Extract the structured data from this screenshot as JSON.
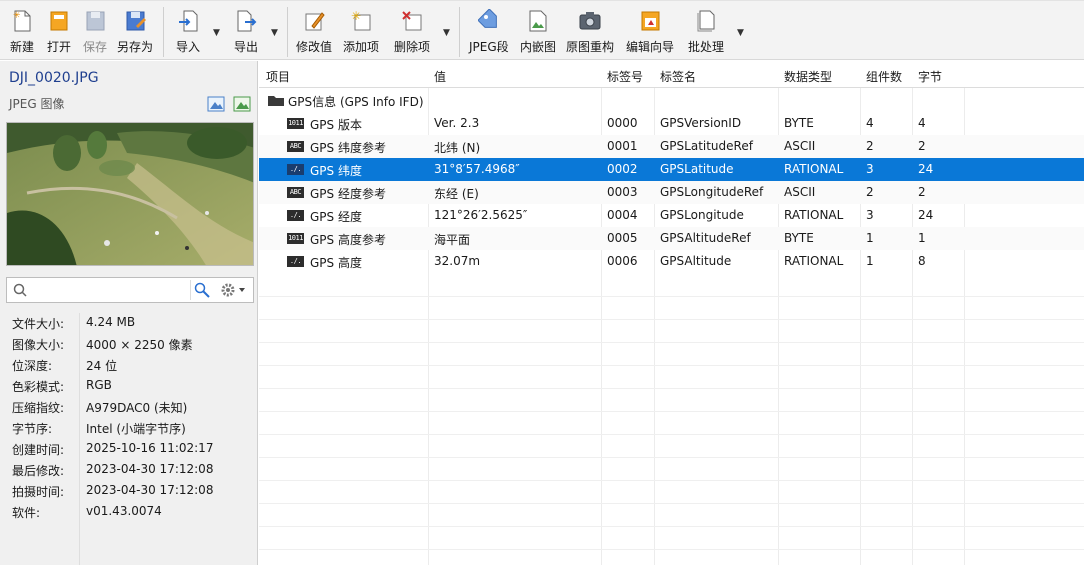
{
  "toolbar": {
    "new": "新建",
    "open": "打开",
    "save": "保存",
    "save_as": "另存为",
    "import": "导入",
    "export": "导出",
    "modify": "修改值",
    "add": "添加项",
    "delete": "删除项",
    "jpeg_seg": "JPEG段",
    "embedded": "内嵌图",
    "rebuild": "原图重构",
    "wizard": "编辑向导",
    "batch": "批处理"
  },
  "file": {
    "name": "DJI_0020.JPG",
    "type": "JPEG 图像"
  },
  "search": {
    "placeholder": ""
  },
  "properties": [
    {
      "k": "文件大小:",
      "v": "4.24 MB"
    },
    {
      "k": "图像大小:",
      "v": "4000 × 2250 像素"
    },
    {
      "k": "位深度:",
      "v": "24 位"
    },
    {
      "k": "色彩模式:",
      "v": "RGB"
    },
    {
      "k": "压缩指纹:",
      "v": "A979DAC0 (未知)"
    },
    {
      "k": "字节序:",
      "v": "Intel (小端字节序)"
    },
    {
      "k": "创建时间:",
      "v": "2025-10-16 11:02:17"
    },
    {
      "k": "最后修改:",
      "v": "2023-04-30 17:12:08"
    },
    {
      "k": "拍摄时间:",
      "v": "2023-04-30 17:12:08"
    },
    {
      "k": "软件:",
      "v": "v01.43.0074"
    }
  ],
  "columns": [
    "项目",
    "值",
    "标签号",
    "标签名",
    "数据类型",
    "组件数",
    "字节"
  ],
  "group": "GPS信息 (GPS Info IFD)",
  "rows": [
    {
      "icon": "1011",
      "item": "GPS 版本",
      "value": "Ver. 2.3",
      "tag": "0000",
      "name": "GPSVersionID",
      "type": "BYTE",
      "count": "4",
      "bytes": "4"
    },
    {
      "icon": "ABC",
      "item": "GPS 纬度参考",
      "value": "北纬 (N)",
      "tag": "0001",
      "name": "GPSLatitudeRef",
      "type": "ASCII",
      "count": "2",
      "bytes": "2"
    },
    {
      "icon": "./.",
      "item": "GPS 纬度",
      "value": "31°8′57.4968″",
      "tag": "0002",
      "name": "GPSLatitude",
      "type": "RATIONAL",
      "count": "3",
      "bytes": "24"
    },
    {
      "icon": "ABC",
      "item": "GPS 经度参考",
      "value": "东经 (E)",
      "tag": "0003",
      "name": "GPSLongitudeRef",
      "type": "ASCII",
      "count": "2",
      "bytes": "2"
    },
    {
      "icon": "./.",
      "item": "GPS 经度",
      "value": "121°26′2.5625″",
      "tag": "0004",
      "name": "GPSLongitude",
      "type": "RATIONAL",
      "count": "3",
      "bytes": "24"
    },
    {
      "icon": "1011",
      "item": "GPS 高度参考",
      "value": "海平面",
      "tag": "0005",
      "name": "GPSAltitudeRef",
      "type": "BYTE",
      "count": "1",
      "bytes": "1"
    },
    {
      "icon": "./.",
      "item": "GPS 高度",
      "value": "32.07m",
      "tag": "0006",
      "name": "GPSAltitude",
      "type": "RATIONAL",
      "count": "1",
      "bytes": "8"
    }
  ],
  "selected_row": 2,
  "colors": {
    "selection": "#0a78d7"
  }
}
